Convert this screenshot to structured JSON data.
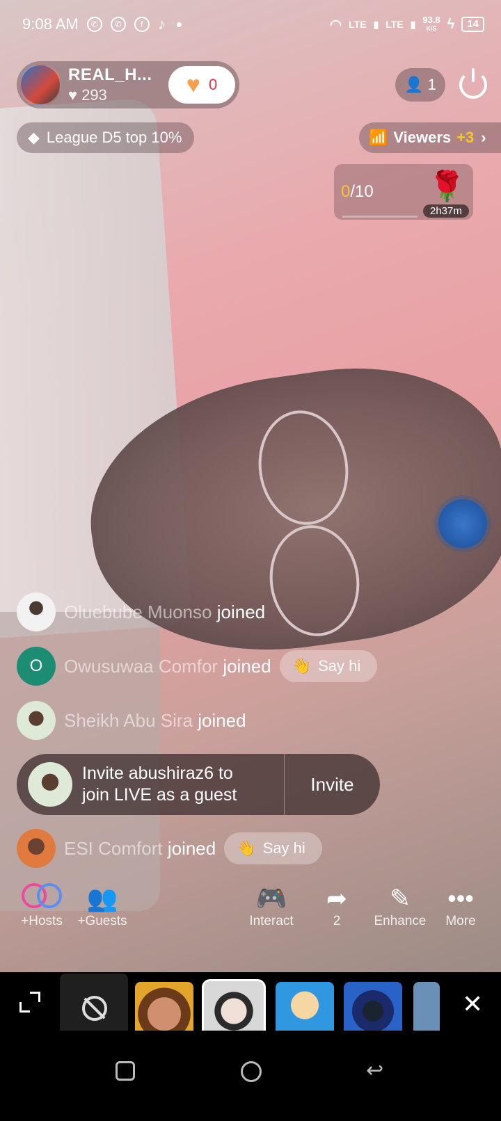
{
  "status_bar": {
    "time": "9:08 AM",
    "network1": "LTE",
    "network2": "LTE",
    "speed": "93.8",
    "speed_unit": "K/S",
    "battery": "14"
  },
  "host": {
    "name": "REAL_H...",
    "likes": "293",
    "heart_count": "0"
  },
  "viewer_count": "1",
  "league_label": "League D5 top 10%",
  "viewers": {
    "label": "Viewers",
    "delta": "+3"
  },
  "goal": {
    "current": "0",
    "total": "/10",
    "timer": "2h37m"
  },
  "feed": [
    {
      "name": "Oluebube Muonso",
      "action": "joined",
      "say_hi": ""
    },
    {
      "name": "Owusuwaa Comfor",
      "action": "joined",
      "initial": "O",
      "say_hi": "Say hi"
    },
    {
      "name": "Sheikh Abu Sira",
      "action": "joined",
      "say_hi": ""
    },
    {
      "name": "ESI Comfort",
      "action": "joined",
      "say_hi": "Say hi"
    }
  ],
  "invite": {
    "line1": "Invite abushiraz6 to",
    "line2": "join LIVE as a guest",
    "button": "Invite"
  },
  "toolbar": {
    "hosts": "+Hosts",
    "guests": "+Guests",
    "interact": "Interact",
    "share_count": "2",
    "enhance": "Enhance",
    "more": "More"
  },
  "colors": {
    "accent_yellow": "#f7c531",
    "heart_orange": "#f6a04d",
    "like_red": "#e8344a"
  }
}
